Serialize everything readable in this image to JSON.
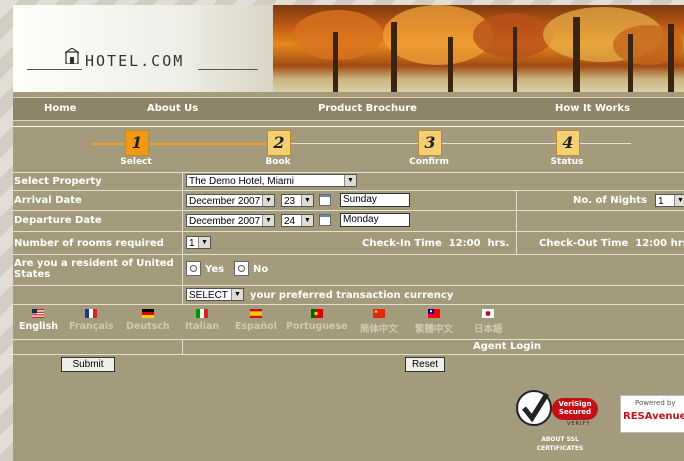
{
  "header": {
    "logo": "HOTEL.COM"
  },
  "nav": [
    "Home",
    "About Us",
    "Product Brochure",
    "How It Works"
  ],
  "steps": [
    {
      "num": "1",
      "label": "Select",
      "active": true
    },
    {
      "num": "2",
      "label": "Book",
      "active": false
    },
    {
      "num": "3",
      "label": "Confirm",
      "active": false
    },
    {
      "num": "4",
      "label": "Status",
      "active": false
    }
  ],
  "form": {
    "select_property_label": "Select Property",
    "property_value": "The Demo Hotel, Miami",
    "arrival_label": "Arrival Date",
    "arrival_month": "December 2007",
    "arrival_day": "23",
    "arrival_weekday": "Sunday",
    "nights_label": "No. of Nights",
    "nights_value": "1",
    "departure_label": "Departure Date",
    "departure_month": "December 2007",
    "departure_day": "24",
    "departure_weekday": "Monday",
    "rooms_label": "Number of rooms required",
    "rooms_value": "1",
    "checkin_text": "Check-In Time  12:00  hrs.",
    "checkout_text": "Check-Out Time  12:00 hrs",
    "resident_label": "Are you a resident of United States",
    "yes_label": "Yes",
    "no_label": "No",
    "currency_value": "SELECT",
    "currency_text": "your preferred transaction currency"
  },
  "languages": [
    {
      "name": "English",
      "current": true
    },
    {
      "name": "Français",
      "current": false
    },
    {
      "name": "Deutsch",
      "current": false
    },
    {
      "name": "Italian",
      "current": false
    },
    {
      "name": "Español",
      "current": false
    },
    {
      "name": "Portuguese",
      "current": false
    },
    {
      "name": "简体中文",
      "current": false
    },
    {
      "name": "繁體中文",
      "current": false
    },
    {
      "name": "日本語",
      "current": false
    }
  ],
  "agent_login": "Agent Login",
  "buttons": {
    "submit": "Submit",
    "reset": "Reset"
  },
  "badges": {
    "verisign_line1": "VeriSign",
    "verisign_line2": "Secured",
    "verisign_verify": "VERIFY",
    "about_ssl_1": "ABOUT SSL",
    "about_ssl_2": "CERTIFICATES",
    "powered_by": "Powered by",
    "resavenue": "RESAvenue"
  },
  "colors": {
    "page_bg": "#a49b7c",
    "nav_bg": "#8e8468",
    "step_active": "#f29a14",
    "step_inactive": "#f4cf73"
  }
}
